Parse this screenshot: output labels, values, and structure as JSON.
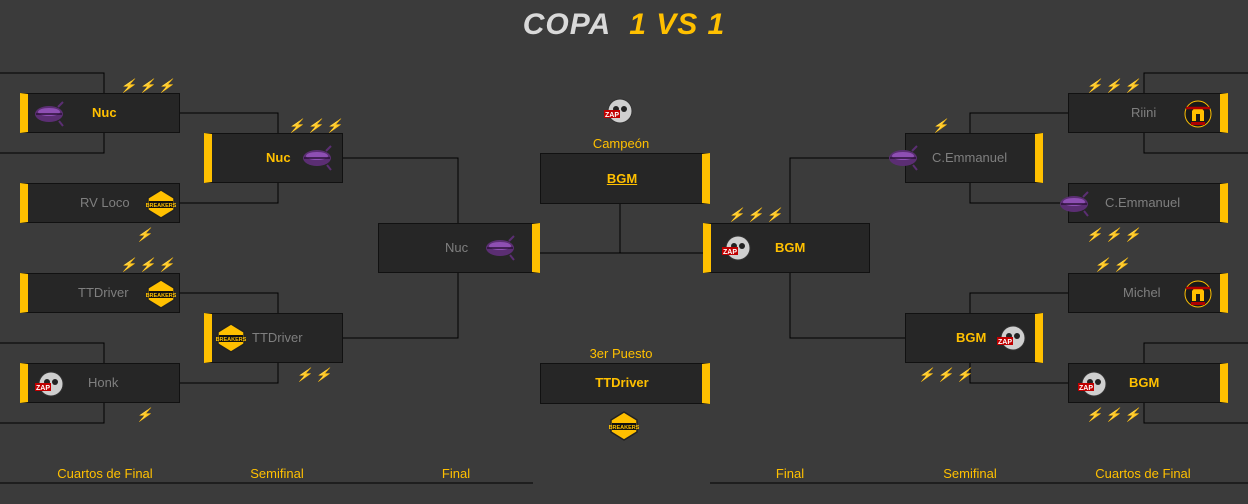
{
  "title": {
    "part1": "COPA",
    "part2": "1 VS 1"
  },
  "rounds": {
    "left_quarter": "Cuartos de Final",
    "left_semi": "Semifinal",
    "left_final": "Final",
    "right_final": "Final",
    "right_semi": "Semifinal",
    "right_quarter": "Cuartos de Final"
  },
  "center": {
    "champion_label": "Campeón",
    "champion_name": "BGM",
    "third_label": "3er Puesto",
    "third_name": "TTDriver"
  },
  "left_quarters": [
    {
      "name": "Nuc",
      "winner": true,
      "logo": "purple-blimp-icon",
      "bolts": "⚡⚡⚡"
    },
    {
      "name": "RV Loco",
      "winner": false,
      "logo": "breakers-badge-icon",
      "bolts": "⚡"
    },
    {
      "name": "TTDriver",
      "winner": false,
      "logo": "breakers-badge-icon",
      "bolts": "⚡⚡⚡"
    },
    {
      "name": "Honk",
      "winner": false,
      "logo": "zap-skull-icon",
      "bolts": "⚡"
    }
  ],
  "left_semis": [
    {
      "name": "Nuc",
      "winner": true,
      "logo": "purple-blimp-icon",
      "bolts": "⚡⚡⚡"
    },
    {
      "name": "TTDriver",
      "winner": false,
      "logo": "breakers-badge-icon",
      "bolts": "⚡⚡"
    }
  ],
  "left_final": {
    "name": "Nuc",
    "winner": false,
    "logo": "purple-blimp-icon"
  },
  "right_final": {
    "name": "BGM",
    "winner": true,
    "logo": "zap-skull-icon",
    "bolts": "⚡⚡⚡"
  },
  "right_semis": [
    {
      "name": "C.Emmanuel",
      "winner": false,
      "logo": "purple-blimp-icon",
      "bolts": "⚡"
    },
    {
      "name": "BGM",
      "winner": true,
      "logo": "zap-skull-icon",
      "bolts": "⚡⚡⚡"
    }
  ],
  "right_quarters": [
    {
      "name": "Riini",
      "winner": false,
      "logo": "spartan-helmet-icon",
      "bolts": "⚡⚡⚡"
    },
    {
      "name": "C.Emmanuel",
      "winner": false,
      "logo": "purple-blimp-icon",
      "bolts": "⚡⚡⚡"
    },
    {
      "name": "Michel",
      "winner": false,
      "logo": "spartan-helmet-icon",
      "bolts": "⚡⚡"
    },
    {
      "name": "BGM",
      "winner": true,
      "logo": "zap-skull-icon",
      "bolts": "⚡⚡⚡"
    }
  ],
  "colors": {
    "accent": "#ffc000",
    "box": "#262626",
    "loser_text": "#7f7f7f",
    "background": "#3b3b3b"
  }
}
